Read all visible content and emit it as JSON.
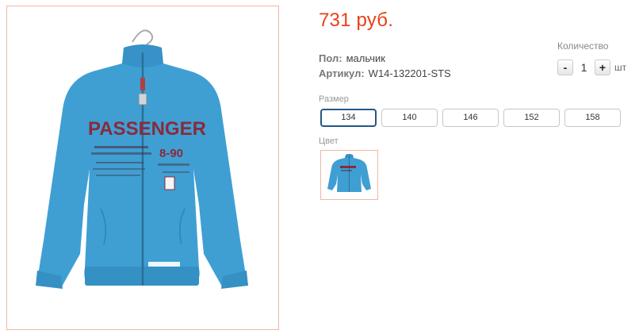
{
  "product": {
    "price": "731 руб.",
    "image_icon": "blue-zip-sweatshirt-image",
    "print_text": "PASSENGER",
    "print_number": "8-90"
  },
  "props": [
    {
      "key": "Пол:",
      "value": "мальчик"
    },
    {
      "key": "Артикул:",
      "value": "W14-132201-STS"
    }
  ],
  "quantity": {
    "label": "Количество",
    "minus": "-",
    "value": "1",
    "plus": "+",
    "unit": "шт"
  },
  "size": {
    "label": "Размер",
    "options": [
      "134",
      "140",
      "146",
      "152",
      "158"
    ],
    "selected": "134"
  },
  "color": {
    "label": "Цвет"
  },
  "colors": {
    "price": "#e8401c",
    "garment": "#3f9fd3",
    "print": "#8a2a3a",
    "selected_border": "#24578a"
  }
}
